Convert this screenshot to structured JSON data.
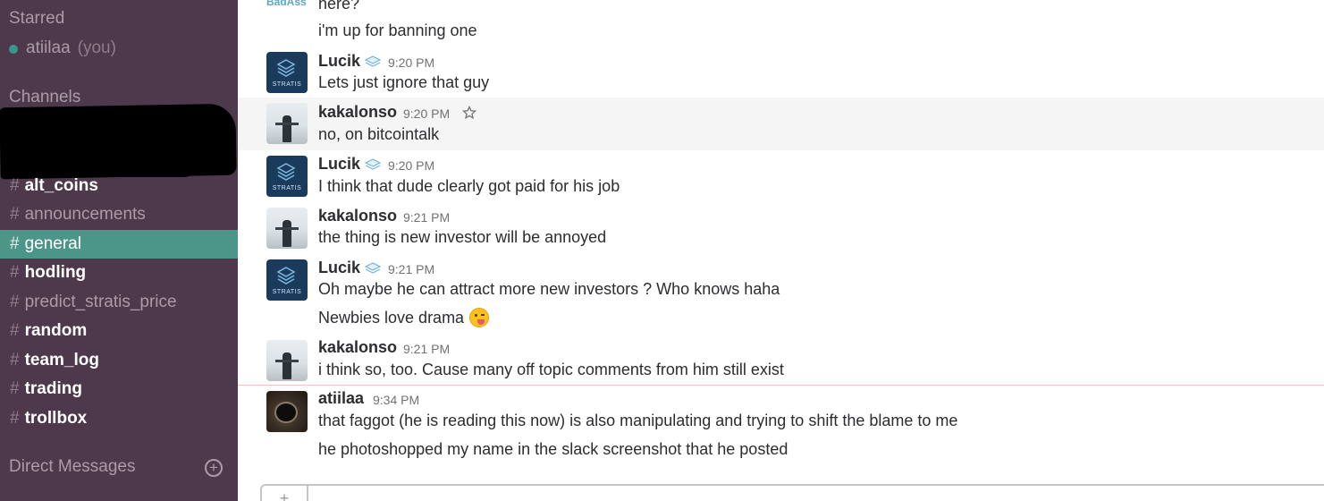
{
  "sidebar": {
    "starred_heading": "Starred",
    "you": {
      "name": "atiilaa",
      "tag": "(you)"
    },
    "channels_heading": "Channels",
    "channels": [
      {
        "name": "alt_coins",
        "unread": true,
        "active": false
      },
      {
        "name": "announcements",
        "unread": false,
        "active": false
      },
      {
        "name": "general",
        "unread": false,
        "active": true
      },
      {
        "name": "hodling",
        "unread": true,
        "active": false
      },
      {
        "name": "predict_stratis_price",
        "unread": false,
        "active": false
      },
      {
        "name": "random",
        "unread": true,
        "active": false
      },
      {
        "name": "team_log",
        "unread": true,
        "active": false
      },
      {
        "name": "trading",
        "unread": true,
        "active": false
      },
      {
        "name": "trollbox",
        "unread": true,
        "active": false
      }
    ],
    "hash_symbol": "#",
    "dm_heading": "Direct Messages",
    "add_symbol": "+"
  },
  "messages": {
    "partial_author": "BadAss",
    "partial_text": "here?",
    "m0_text": "i'm up for banning one",
    "m1": {
      "author": "Lucik",
      "time": "9:20 PM",
      "text": "Lets just ignore that guy"
    },
    "m2": {
      "author": "kakalonso",
      "time": "9:20 PM",
      "text": "no, on bitcointalk"
    },
    "m3": {
      "author": "Lucik",
      "time": "9:20 PM",
      "text": "I think that dude clearly got paid for his job"
    },
    "m4": {
      "author": "kakalonso",
      "time": "9:21 PM",
      "text": "the thing is new investor will be annoyed"
    },
    "m5": {
      "author": "Lucik",
      "time": "9:21 PM",
      "text": "Oh maybe he can attract more new investors ? Who knows haha",
      "text2": "Newbies love drama"
    },
    "m6": {
      "author": "kakalonso",
      "time": "9:21 PM",
      "text": "i think so, too. Cause many off topic comments from him still exist"
    },
    "m7": {
      "author": "atiilaa",
      "time": "9:34 PM",
      "text": "that faggot (he is reading this now) is also manipulating and trying to shift the blame to me",
      "text2": "he photoshopped my name in the slack screenshot that he posted"
    },
    "stratis_label": "STRATIS"
  },
  "composer": {
    "plus_symbol": "+"
  },
  "colors": {
    "sidebar_bg": "#4d394b",
    "active_channel": "#4c9689",
    "presence": "#38978d"
  },
  "icons": {
    "badge": "stratis-badge-icon",
    "star": "star-icon",
    "emoji": "yum-emoji-icon"
  }
}
